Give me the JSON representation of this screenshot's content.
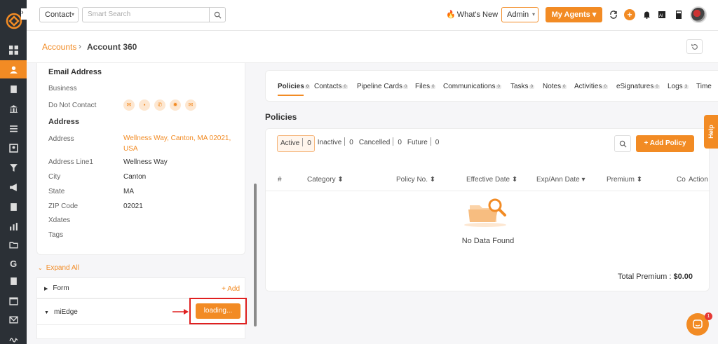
{
  "topbar": {
    "entity_select": "Contact",
    "search_placeholder": "Smart Search",
    "whats_new": "What's New",
    "role_select": "Admin",
    "my_agents": "My Agents",
    "notification_count": ""
  },
  "breadcrumb": {
    "parent": "Accounts",
    "separator": "›",
    "current": "Account 360"
  },
  "details": {
    "email_heading": "Email Address",
    "business_label": "Business",
    "dnc_label": "Do Not Contact",
    "address_heading": "Address",
    "rows": [
      {
        "label": "Address",
        "value": "Wellness Way, Canton, MA 02021, USA"
      },
      {
        "label": "Address Line1",
        "value": "Wellness Way"
      },
      {
        "label": "City",
        "value": "Canton"
      },
      {
        "label": "State",
        "value": "MA"
      },
      {
        "label": "ZIP Code",
        "value": "02021"
      },
      {
        "label": "Xdates",
        "value": ""
      },
      {
        "label": "Tags",
        "value": ""
      }
    ]
  },
  "sections": {
    "expand_all": "Expand All",
    "form_title": "Form",
    "form_add": "+ Add",
    "miedge_title": "miEdge",
    "loading_label": "loading..."
  },
  "tabs": [
    {
      "label": "Policies",
      "count": "0"
    },
    {
      "label": "Contacts",
      "count": "0"
    },
    {
      "label": "Pipeline Cards",
      "count": "0"
    },
    {
      "label": "Files",
      "count": "0"
    },
    {
      "label": "Communications",
      "count": "0"
    },
    {
      "label": "Tasks",
      "count": "0"
    },
    {
      "label": "Notes",
      "count": "0"
    },
    {
      "label": "Activities",
      "count": "0"
    },
    {
      "label": "eSignatures",
      "count": "0"
    },
    {
      "label": "Logs",
      "count": "3"
    },
    {
      "label": "Time",
      "count": ""
    }
  ],
  "policies": {
    "title": "Policies",
    "status_tabs": [
      {
        "label": "Active",
        "count": "0"
      },
      {
        "label": "Inactive",
        "count": "0"
      },
      {
        "label": "Cancelled",
        "count": "0"
      },
      {
        "label": "Future",
        "count": "0"
      }
    ],
    "add_button": "+ Add Policy",
    "columns": [
      "#",
      "Category ⬍",
      "Policy No. ⬍",
      "Effective Date ⬍",
      "Exp/Ann Date ▾",
      "Premium ⬍",
      "Co",
      "Action"
    ],
    "empty_text": "No Data Found",
    "total_label": "Total Premium :",
    "total_value": "$0.00"
  },
  "help": {
    "label": "Help"
  },
  "chat": {
    "badge": "1"
  },
  "colors": {
    "accent": "#f28b24",
    "sidebar": "#2b3036",
    "highlight": "#e02020"
  }
}
